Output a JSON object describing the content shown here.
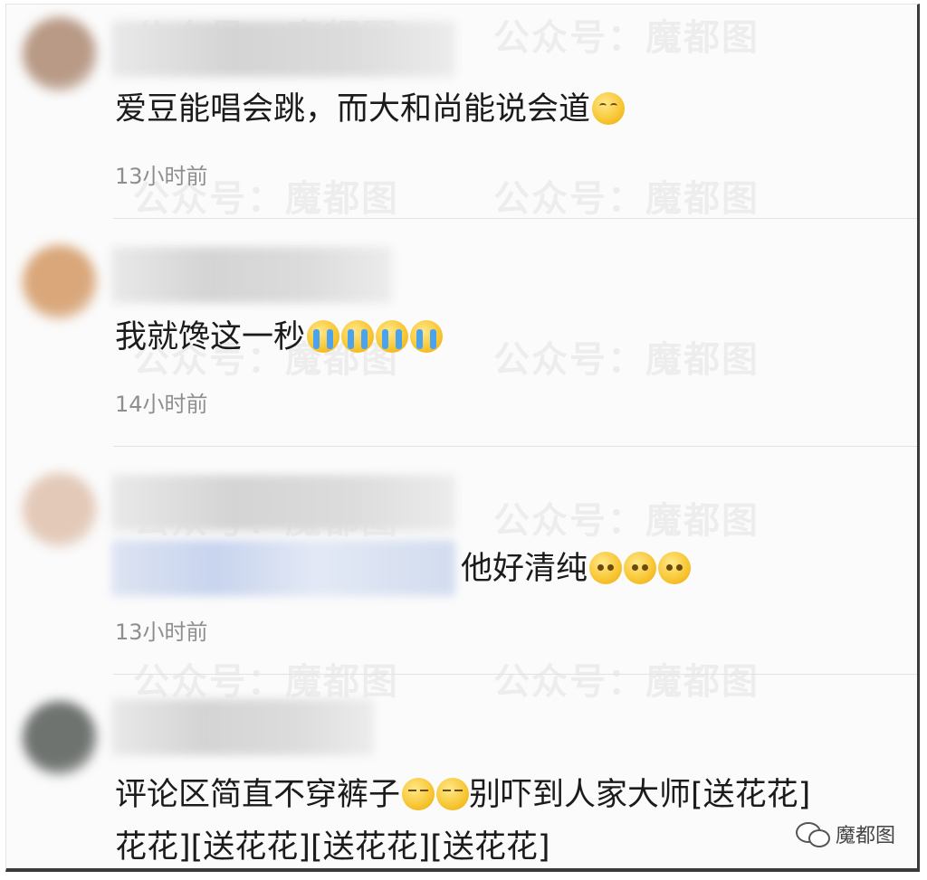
{
  "watermark": "公众号：魔都图",
  "comments": [
    {
      "avatar_color": "#b89a86",
      "text": "爱豆能唱会跳，而大和尚能说会道",
      "emojis": [
        "smile"
      ],
      "time": "13小时前"
    },
    {
      "avatar_color": "#d9a77a",
      "text": "我就馋这一秒",
      "emojis": [
        "cry",
        "cry",
        "cry",
        "cry"
      ],
      "time": "14小时前"
    },
    {
      "avatar_color": "#e3c9b8",
      "text": "他好清纯",
      "emojis": [
        "shy",
        "shy",
        "shy"
      ],
      "time": "13小时前"
    },
    {
      "avatar_color": "#6f7370",
      "text_part1": "评论区简直不穿裤子",
      "emojis": [
        "smug",
        "smug"
      ],
      "text_part2": "别吓到人家大师[送花花]",
      "text_line2": "花花][送花花][送花花][送花花]"
    }
  ],
  "badge": {
    "label": "魔都图",
    "icon": "wechat-icon"
  }
}
